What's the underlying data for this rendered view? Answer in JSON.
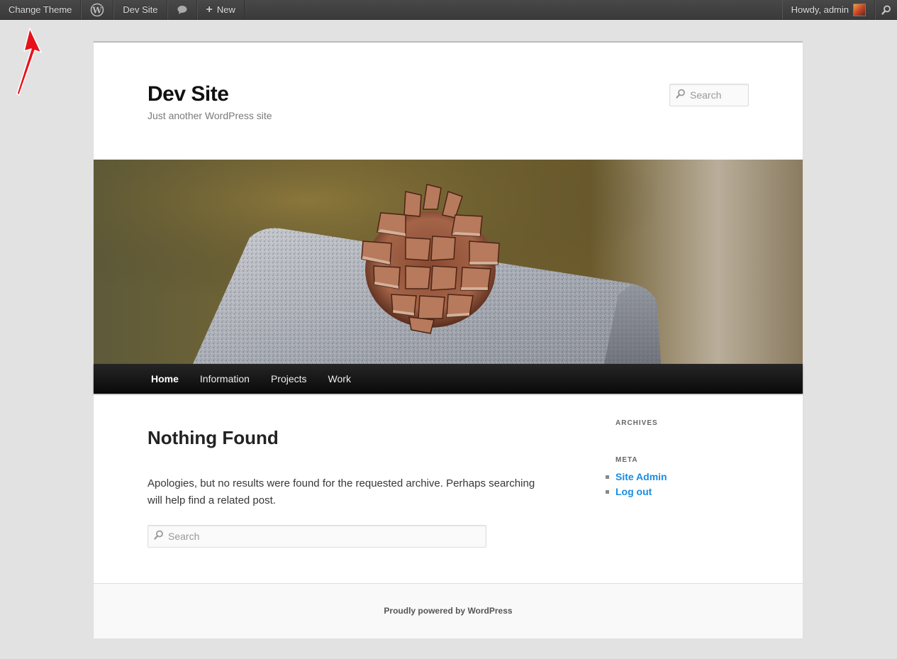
{
  "adminbar": {
    "change_theme": "Change Theme",
    "site_name": "Dev Site",
    "new_label": "New",
    "howdy": "Howdy, admin",
    "icons": {
      "wordpress": "wordpress-logo-icon",
      "comments": "comment-bubble-icon",
      "new": "plus-icon",
      "search": "search-icon"
    }
  },
  "header": {
    "title": "Dev Site",
    "description": "Just another WordPress site",
    "search_placeholder": "Search"
  },
  "nav": {
    "items": [
      {
        "label": "Home",
        "current": true
      },
      {
        "label": "Information",
        "current": false
      },
      {
        "label": "Projects",
        "current": false
      },
      {
        "label": "Work",
        "current": false
      }
    ]
  },
  "content": {
    "title": "Nothing Found",
    "text": "Apologies, but no results were found for the requested archive. Perhaps searching will help find a related post.",
    "search_placeholder": "Search"
  },
  "sidebar": {
    "archives_title": "Archives",
    "meta_title": "Meta",
    "meta_links": [
      "Site Admin",
      "Log out"
    ]
  },
  "footer": {
    "text": "Proudly powered by WordPress"
  },
  "colors": {
    "adminbar_bg": "#464646",
    "link": "#1b8be0",
    "nav_bg": "#0a0a0a",
    "annotation_arrow": "#e8111a"
  }
}
